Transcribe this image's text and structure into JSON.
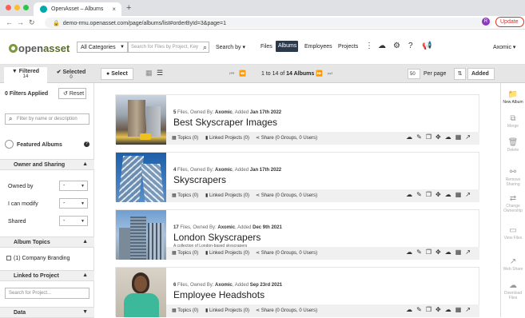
{
  "browser": {
    "tab_title": "OpenAsset – Albums",
    "url": "demo-rmu.openasset.com/page/albums/list#orderById=3&page=1",
    "profile_initial": "R",
    "update_label": "Update"
  },
  "header": {
    "logo_open": "open",
    "logo_asset": "asset",
    "category": "All Categories",
    "search_placeholder": "Search for Files by Project, Key",
    "search_by": "Search by",
    "nav": {
      "files": "Files",
      "albums": "Albums",
      "employees": "Employees",
      "projects": "Projects"
    },
    "user": "Axomic"
  },
  "toolbar": {
    "filtered_label": "Filtered",
    "filtered_count": "14",
    "selected_label": "Selected",
    "selected_count": "0",
    "select_label": "Select",
    "pagination": "1 to 14 of",
    "pagination_total": "14 Albums",
    "per_page_value": "50",
    "per_page_label": "Per page",
    "sort_label": "Added"
  },
  "sidebar": {
    "filters_applied": "0 Filters Applied",
    "reset_label": "Reset",
    "filter_placeholder": "Filter by name or description",
    "featured_label": "Featured Albums",
    "owner_section": "Owner and Sharing",
    "owned_by_label": "Owned by",
    "owned_by_value": "-",
    "can_modify_label": "I can modify",
    "can_modify_value": "-",
    "shared_label": "Shared",
    "shared_value": "-",
    "topics_section": "Album Topics",
    "topic_item": "(1) Company Branding",
    "linked_section": "Linked to Project",
    "project_placeholder": "Search for Project...",
    "data_section": "Data"
  },
  "albums": [
    {
      "files": "5",
      "owner": "Axomic",
      "added": "Jan 17th 2022",
      "title": "Best Skyscraper Images",
      "description": "",
      "topics": "Topics (0)",
      "linked": "Linked Projects (0)",
      "share": "Share (0 Groups, 0 Users)"
    },
    {
      "files": "4",
      "owner": "Axomic",
      "added": "Jan 17th 2022",
      "title": "Skyscrapers",
      "description": "",
      "topics": "Topics (0)",
      "linked": "Linked Projects (0)",
      "share": "Share (0 Groups, 0 Users)"
    },
    {
      "files": "17",
      "owner": "Axomic",
      "added": "Dec 9th 2021",
      "title": "London Skyscrapers",
      "description": "A collection of London-based skyscrapers",
      "topics": "Topics (0)",
      "linked": "Linked Projects (0)",
      "share": "Share (0 Groups, 0 Users)"
    },
    {
      "files": "6",
      "owner": "Axomic",
      "added": "Sep 23rd 2021",
      "title": "Employee Headshots",
      "description": "",
      "topics": "Topics (0)",
      "linked": "Linked Projects (0)",
      "share": "Share (0 Groups, 0 Users)"
    }
  ],
  "album_labels": {
    "files_word": "Files, Owned By:",
    "added_word": ", Added"
  },
  "right_panel": {
    "new_album": "New Album",
    "merge": "Merge",
    "delete": "Delete",
    "remove_sharing": "Remove Sharing",
    "change_owner": "Change Ownership",
    "view_files": "View Files",
    "web_share": "Web Share",
    "download_files": "Download Files"
  },
  "colors": {
    "accent": "#2b3a4b",
    "logo_green": "#7a9a35",
    "update_red": "#d93025"
  }
}
